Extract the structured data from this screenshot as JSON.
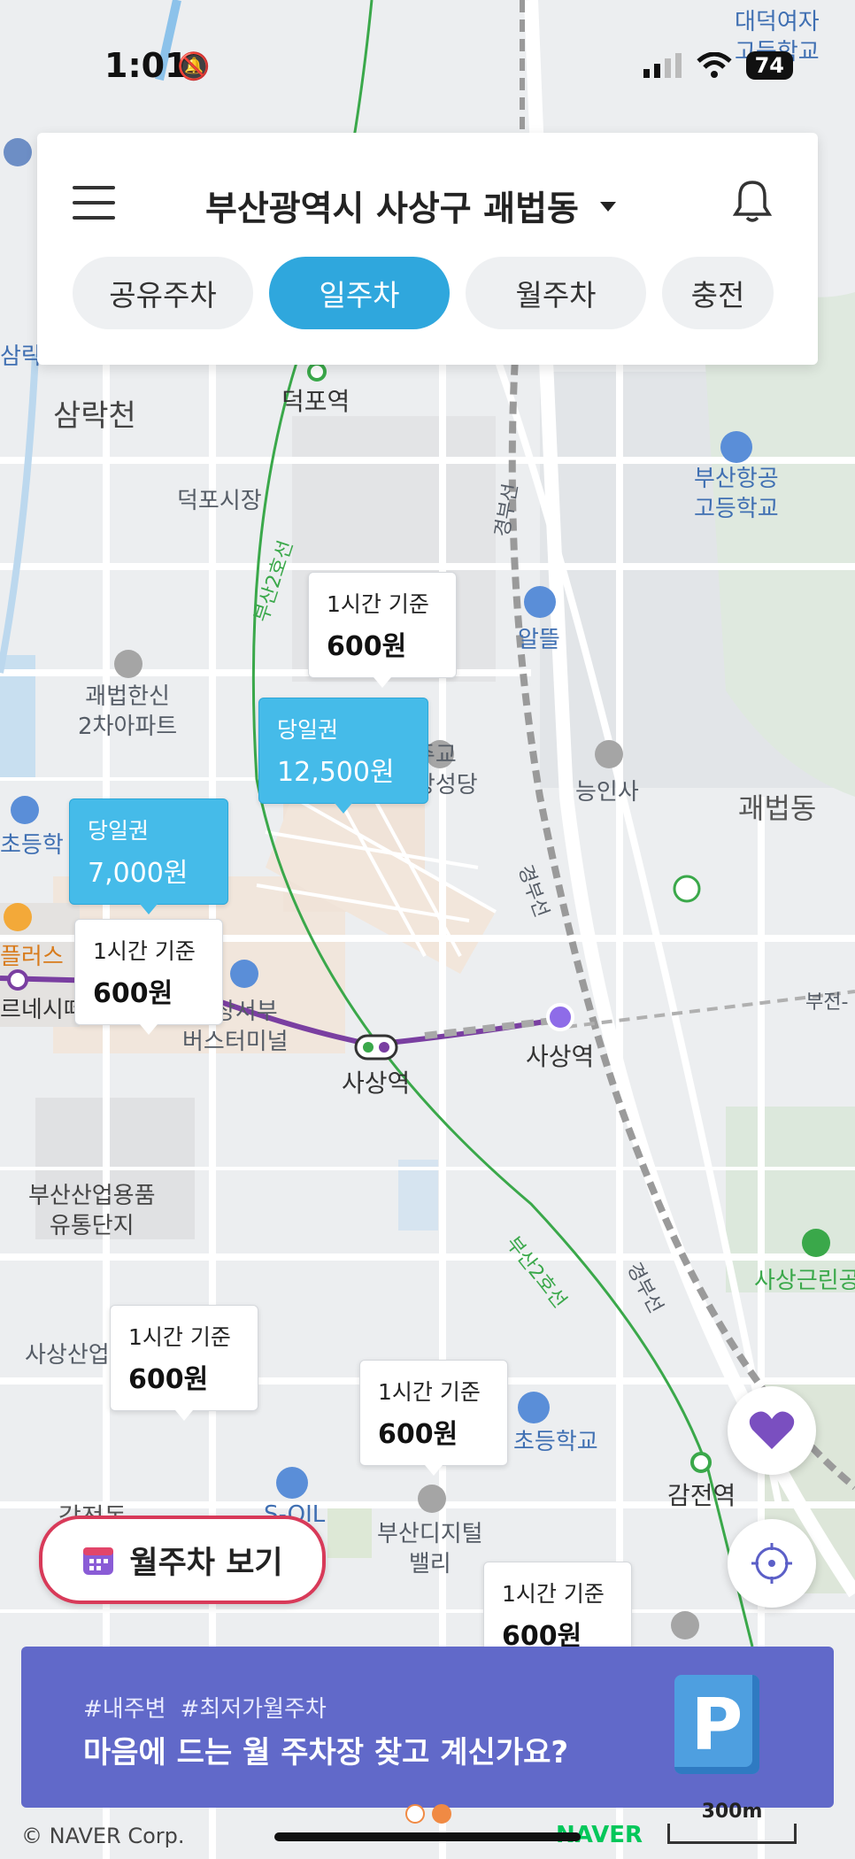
{
  "status_bar": {
    "time": "1:01",
    "battery": "74"
  },
  "header": {
    "location": "부산광역시 사상구 괘법동",
    "tabs": [
      {
        "label": "공유주차",
        "active": false
      },
      {
        "label": "일주차",
        "active": true
      },
      {
        "label": "월주차",
        "active": false
      },
      {
        "label": "충전",
        "active": false
      }
    ]
  },
  "map_labels": {
    "school_top_right": "대덕여자\n고등학교",
    "samrakdong": "삼락천",
    "samrak": "삼락",
    "deokpo_station": "덕포역",
    "deokpo_market": "덕포시장",
    "gwaebeop_apt": "괘법한신\n2차아파트",
    "plus": "플러스",
    "cinema": "르네시떼",
    "elementary_left": "초등학",
    "terminal": "사상서부\n버스터미널",
    "sasang_station": "사상역",
    "sasang_station_2": "사상역",
    "church": "주교\n사상성당",
    "albi": "알뜰",
    "neunginsa": "능인사",
    "gwaebeopdong": "괘법동",
    "port_high": "부산항공\n고등학교",
    "busan_industrial": "부산산업용품\n유통단지",
    "sasang_industrial": "사상산업",
    "elementary_bottom": "초등학교",
    "soil": "S-OIL",
    "digital_valley": "부산디지털\n밸리",
    "gamjeon_station": "감전역",
    "gamjeon": "감전동",
    "sasang_park": "사상근린공",
    "line2_a": "부산2호선",
    "line2_b": "부산2호선",
    "gyeongbu_a": "경부선",
    "gyeongbu_b": "경부선",
    "gyeongbu_c": "경부선",
    "busan_jeon": "부전-"
  },
  "markers": [
    {
      "line1": "1시간 기준",
      "line2": "600원",
      "type": "white"
    },
    {
      "line1": "당일권",
      "line2": "12,500원",
      "type": "blue"
    },
    {
      "line1": "당일권",
      "line2": "7,000원",
      "type": "blue"
    },
    {
      "line1": "1시간 기준",
      "line2": "600원",
      "type": "white"
    },
    {
      "line1": "1시간 기준",
      "line2": "600원",
      "type": "white"
    },
    {
      "line1": "1시간 기준",
      "line2": "600원",
      "type": "white"
    },
    {
      "line1": "1시간 기준",
      "line2": "600원",
      "type": "white"
    }
  ],
  "monthly_button": {
    "label": "월주차 보기"
  },
  "banner": {
    "tags": [
      "#내주변",
      "#최저가월주차"
    ],
    "headline": "마음에 드는 월 주차장 찾고 계신가요?",
    "icon_letter": "P"
  },
  "footer": {
    "copyright": "© NAVER Corp.",
    "brand": "NAVER",
    "scale": "300m"
  },
  "colors": {
    "accent": "#2fa7dd",
    "marker_blue": "#45bbe9",
    "banner": "#6169c9",
    "monthly_border": "#d83a59",
    "heart": "#7a4fc0"
  }
}
